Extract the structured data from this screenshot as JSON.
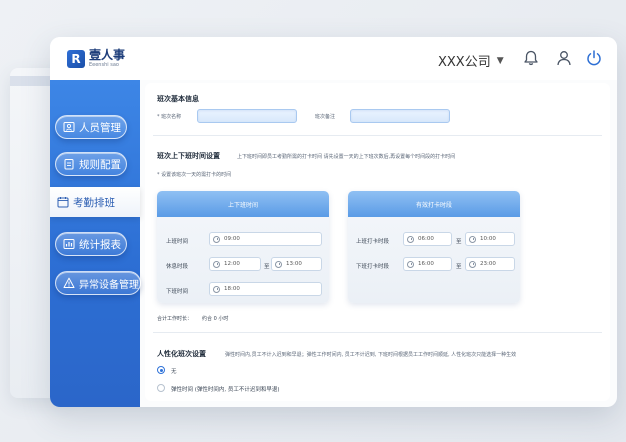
{
  "header": {
    "logo_mark": "R",
    "logo_cn": "壹人事",
    "logo_en": "Eeenshi sao",
    "company": "XXX公司",
    "company_caret": "▼",
    "icons": [
      "bell-icon",
      "user-icon",
      "power-icon"
    ]
  },
  "sidebar": {
    "items": [
      {
        "label": "人员管理",
        "icon": "person-card-icon",
        "active": false
      },
      {
        "label": "规则配置",
        "icon": "clipboard-icon",
        "active": false
      },
      {
        "label": "考勤排班",
        "icon": "calendar-icon",
        "active": true
      },
      {
        "label": "统计报表",
        "icon": "chart-icon",
        "active": false
      },
      {
        "label": "异常设备管理",
        "icon": "warning-icon",
        "active": false
      }
    ]
  },
  "basic": {
    "title": "班次基本信息",
    "name_label": "* 班次名称",
    "note_label": "班次备注"
  },
  "time_setting": {
    "title": "班次上下班时间设置",
    "desc": "上下班时间即员工考勤所需的打卡时间 请先设置一天的上下班次数后,再设置每个时间段的打卡时间",
    "sub": "* 设置该班次一天的需打卡的时间"
  },
  "work_card": {
    "title": "上下班时间",
    "rows": [
      {
        "label": "上班时间",
        "value": "09:00"
      },
      {
        "label": "休息时段",
        "from": "12:00",
        "sep": "至",
        "to": "13:00"
      },
      {
        "label": "下班时间",
        "value": "18:00"
      }
    ]
  },
  "punch_card": {
    "title": "有效打卡时段",
    "rows": [
      {
        "label": "上班打卡时段",
        "from": "06:00",
        "sep": "至",
        "to": "10:00"
      },
      {
        "label": "下班打卡时段",
        "from": "16:00",
        "sep": "至",
        "to": "23:00"
      }
    ]
  },
  "total": {
    "label": "合计工作时长：",
    "value": "约合 0 小时"
  },
  "humane": {
    "title": "人性化班次设置",
    "desc": "弹性时间内,员工不计入迟到和早退；弹性工作时间内, 员工不计迟到, 下班时间根据员工工作时间顺延, 人性化班次只能选择一种生效",
    "options": [
      {
        "label": "无",
        "selected": true
      },
      {
        "label": "弹性时间 (弹性时间内, 员工不计迟到和早退)",
        "selected": false
      }
    ]
  }
}
